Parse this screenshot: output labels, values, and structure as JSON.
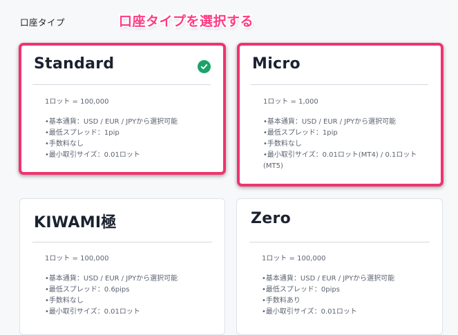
{
  "section": {
    "label": "口座タイプ",
    "annotation": "口座タイプを選択する"
  },
  "colors": {
    "annotation": "#ff3b82",
    "highlight_border": "#f0336f",
    "check": "#1ca36a"
  },
  "cards": [
    {
      "title": "Standard",
      "selected": true,
      "icon": "check-circle-icon",
      "lot": "1ロット = 100,000",
      "features": [
        "基本通貨：USD / EUR / JPYから選択可能",
        "最低スプレッド：1pip",
        "手数料なし",
        "最小取引サイズ：0.01ロット"
      ]
    },
    {
      "title": "Micro",
      "selected": false,
      "lot": "1ロット = 1,000",
      "features": [
        "基本通貨：USD / EUR / JPYから選択可能",
        "最低スプレッド：1pip",
        "手数料なし",
        "最小取引サイズ：0.01ロット(MT4) / 0.1ロット(MT5)"
      ]
    },
    {
      "title": "KIWAMI極",
      "selected": false,
      "lot": "1ロット = 100,000",
      "features": [
        "基本通貨：USD / EUR / JPYから選択可能",
        "最低スプレッド：0.6pips",
        "手数料なし",
        "最小取引サイズ：0.01ロット"
      ]
    },
    {
      "title": "Zero",
      "selected": false,
      "lot": "1ロット = 100,000",
      "features": [
        "基本通貨：USD / EUR / JPYから選択可能",
        "最低スプレッド：0pips",
        "手数料あり",
        "最小取引サイズ：0.01ロット"
      ]
    }
  ]
}
